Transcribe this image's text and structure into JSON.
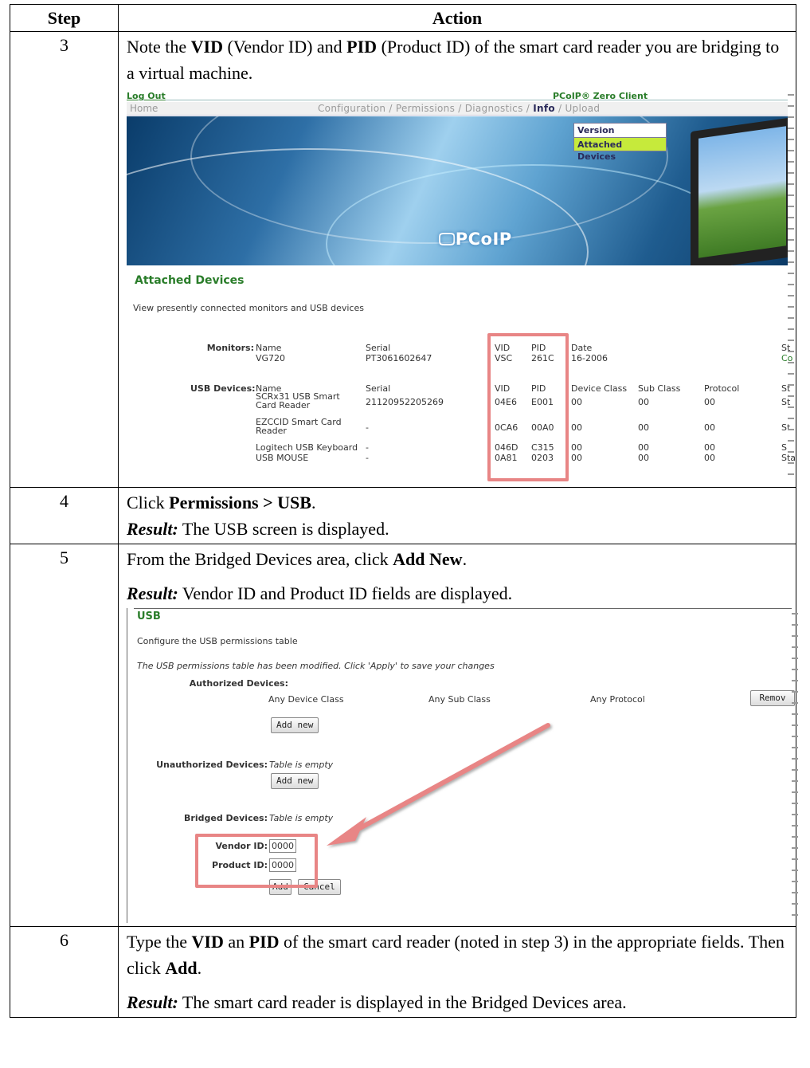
{
  "table": {
    "header": {
      "step": "Step",
      "action": "Action"
    }
  },
  "step3": {
    "number": "3",
    "t1": "Note the ",
    "b1": "VID",
    "t2": " (Vendor ID) and ",
    "b2": "PID",
    "t3": " (Product ID) of the smart card reader you are bridging to a virtual machine."
  },
  "shot1": {
    "logout": "Log Out",
    "brand": "PCoIP® Zero Client",
    "nav_home": "Home",
    "nav_pre": "Configuration / Permissions / Diagnostics / ",
    "nav_active": "Info",
    "nav_post": " / Upload",
    "dropdown_version": "Version",
    "dropdown_attached": "Attached Devices",
    "logo": "PCoIP",
    "title": "Attached Devices",
    "subtitle": "View presently connected monitors and USB devices",
    "monitors_label": "Monitors:",
    "monitor_headers": {
      "name": "Name",
      "serial": "Serial",
      "vid": "VID",
      "pid": "PID",
      "date": "Date",
      "st": "St"
    },
    "monitor_row": {
      "name": "VG720",
      "serial": "PT3061602647",
      "vid": "VSC",
      "pid": "261C",
      "date": "16-2006",
      "st": "Co"
    },
    "usb_label": "USB Devices:",
    "usb_headers": {
      "name": "Name",
      "serial": "Serial",
      "vid": "VID",
      "pid": "PID",
      "device_class": "Device Class",
      "sub_class": "Sub Class",
      "protocol": "Protocol",
      "st": "St"
    },
    "usb_rows": [
      {
        "name": "SCRx31 USB Smart Card Reader",
        "serial": "21120952205269",
        "vid": "04E6",
        "pid": "E001",
        "dc": "00",
        "sc": "00",
        "pr": "00",
        "st": "St"
      },
      {
        "name": "EZCCID Smart Card Reader",
        "serial": "-",
        "vid": "0CA6",
        "pid": "00A0",
        "dc": "00",
        "sc": "00",
        "pr": "00",
        "st": "St"
      },
      {
        "name": "Logitech USB Keyboard",
        "serial": "-",
        "vid": "046D",
        "pid": "C315",
        "dc": "00",
        "sc": "00",
        "pr": "00",
        "st": "S"
      },
      {
        "name": "USB MOUSE",
        "serial": "-",
        "vid": "0A81",
        "pid": "0203",
        "dc": "00",
        "sc": "00",
        "pr": "00",
        "st": "Sta"
      }
    ]
  },
  "step4": {
    "number": "4",
    "t1": "Click ",
    "b1": "Permissions > USB",
    "t2": ".",
    "result_label": "Result:",
    "result_text": " The USB screen is displayed."
  },
  "step5": {
    "number": "5",
    "t1": "From the Bridged Devices area, click ",
    "b1": "Add New",
    "t2": ".",
    "result_label": "Result:",
    "result_text": " Vendor ID and Product ID fields are displayed."
  },
  "shot2": {
    "title": "USB",
    "subtitle": "Configure the USB permissions table",
    "modified_note": "The USB permissions table has been modified. Click 'Apply' to save your changes",
    "authorized_label": "Authorized Devices:",
    "any_device_class": "Any Device Class",
    "any_sub_class": "Any Sub Class",
    "any_protocol": "Any Protocol",
    "remove_button": "Remov",
    "add_new_1": "Add new",
    "unauthorized_label": "Unauthorized Devices:",
    "unauthorized_empty": "Table is empty",
    "add_new_2": "Add new",
    "bridged_label": "Bridged Devices:",
    "bridged_empty": "Table is empty",
    "vendor_id_label": "Vendor ID:",
    "vendor_id_value": "0000",
    "product_id_label": "Product ID:",
    "product_id_value": "0000",
    "add_button": "Add",
    "cancel_button": "Cancel",
    "accent_color": "#e88585"
  },
  "step6": {
    "number": "6",
    "t1": "Type the ",
    "b1": "VID",
    "t2": " an ",
    "b2": "PID",
    "t3": " of the smart card reader (noted in step 3) in the appropriate fields. Then click ",
    "b3": "Add",
    "t4": ".",
    "result_label": "Result:",
    "result_text": " The smart card reader is displayed in the Bridged Devices area."
  }
}
